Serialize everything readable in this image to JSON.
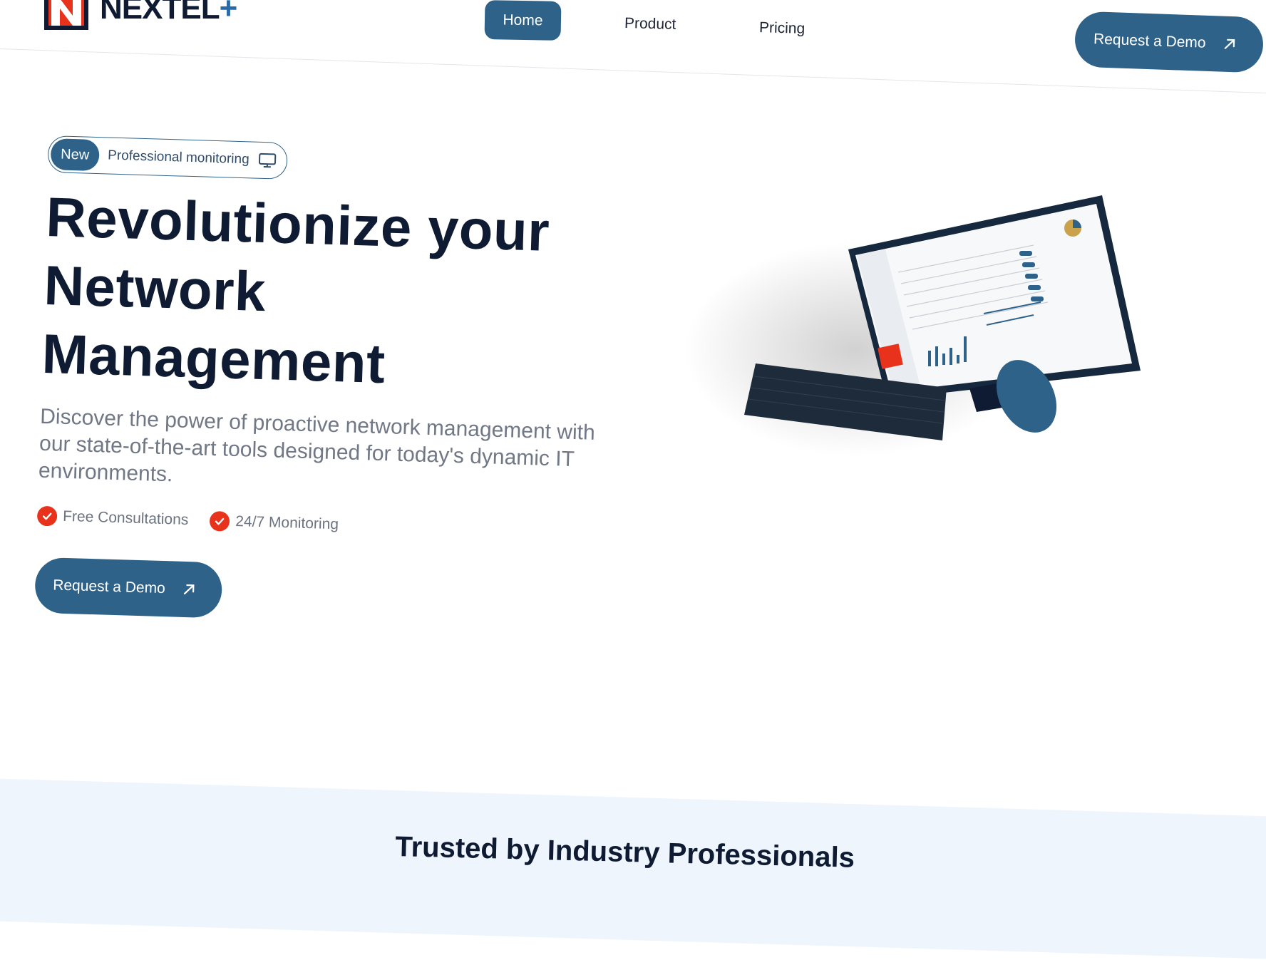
{
  "brand": {
    "name": "NEXTEL",
    "plus": "+"
  },
  "nav": {
    "home": "Home",
    "product": "Product",
    "pricing": "Pricing",
    "cta": "Request a Demo"
  },
  "hero": {
    "badge_new": "New",
    "badge_text": "Professional monitoring",
    "headline_1": "Revolutionize your",
    "headline_2": "Network",
    "headline_3": "Management",
    "subtext": "Discover the power of proactive network management with our state-of-the-art tools designed for today's dynamic IT environments.",
    "check_1": "Free Consultations",
    "check_2": "24/7 Monitoring",
    "cta": "Request a Demo"
  },
  "trusted": {
    "title": "Trusted by Industry Professionals"
  },
  "colors": {
    "primary": "#2f6289",
    "accent": "#e8321b",
    "ink": "#0e1b33",
    "band": "#eef5fd"
  },
  "icons": {
    "arrow": "arrow-up-right-icon",
    "monitor": "monitor-icon",
    "check": "check-circle-icon"
  }
}
